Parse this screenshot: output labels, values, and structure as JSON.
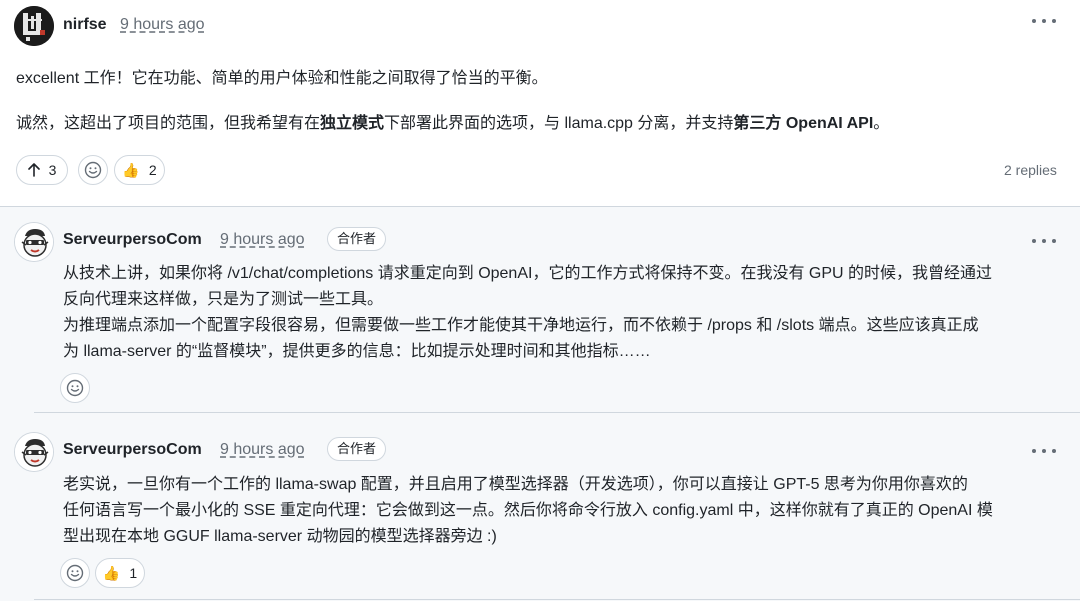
{
  "main_comment": {
    "author": "nirfse",
    "timestamp": "9 hours ago",
    "paragraph1": "excellent 工作！它在功能、简单的用户体验和性能之间取得了恰当的平衡。",
    "paragraph2": {
      "part1": "诚然，这超出了项目的范围，但我希望有在",
      "bold1": "独立模式",
      "part2": "下部署此界面的选项，与 llama.cpp 分离，并支持",
      "bold2": "第三方 OpenAI API",
      "part3": "。"
    },
    "reactions": {
      "upvote_count": "3",
      "thumbs_emoji": "👍",
      "thumbs_count": "2"
    },
    "replies_count": "2 replies"
  },
  "replies": [
    {
      "author": "ServeurpersoCom",
      "timestamp": "9 hours ago",
      "role": "合作者",
      "lines": [
        "从技术上讲，如果你将 /v1/chat/completions 请求重定向到 OpenAI，它的工作方式将保持不变。在我没有 GPU 的时候，我曾经通过",
        "反向代理来这样做，只是为了测试一些工具。",
        "为推理端点添加一个配置字段很容易，但需要做一些工作才能使其干净地运行，而不依赖于 /props 和 /slots 端点。这些应该真正成",
        "为 llama-server 的“监督模块”，提供更多的信息：比如提示处理时间和其他指标……"
      ]
    },
    {
      "author": "ServeurpersoCom",
      "timestamp": "9 hours ago",
      "role": "合作者",
      "lines": [
        "老实说，一旦你有一个工作的 llama-swap 配置，并且启用了模型选择器（开发选项），你可以直接让 GPT-5 思考为你用你喜欢的",
        "任何语言写一个最小化的 SSE 重定向代理：它会做到这一点。然后你将命令行放入 config.yaml 中，这样你就有了真正的 OpenAI 模",
        "型出现在本地 GGUF llama-server 动物园的模型选择器旁边 :)"
      ],
      "reactions": {
        "thumbs_emoji": "👍",
        "thumbs_count": "1"
      }
    }
  ],
  "colors": {
    "text": "#1f2328",
    "muted": "#656d76",
    "border": "#d0d7de",
    "reply_bg": "#f6f8fa",
    "avatar_red": "#c0392b"
  },
  "icons": [
    "kebab-menu-icon",
    "arrow-up-icon",
    "smiley-icon",
    "thumbs-up-icon"
  ]
}
